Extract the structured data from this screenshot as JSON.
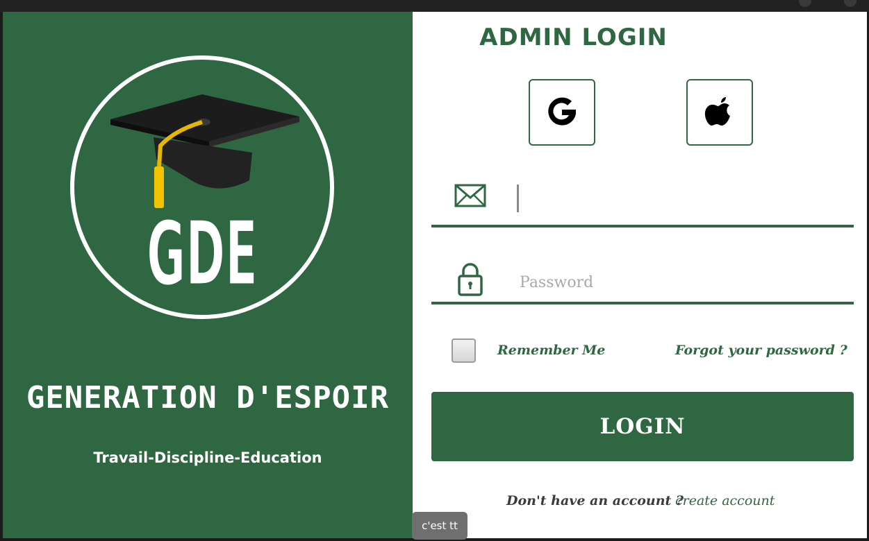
{
  "brand": {
    "logo_initials": "GDE",
    "name": "GENERATION D'ESPOIR",
    "motto": "Travail-Discipline-Education"
  },
  "login": {
    "title": "ADMIN LOGIN",
    "social": [
      {
        "icon": "google-icon"
      },
      {
        "icon": "apple-icon"
      }
    ],
    "email": {
      "value": "",
      "placeholder": "",
      "icon": "envelope-icon"
    },
    "password": {
      "value": "",
      "placeholder": "Password",
      "icon": "lock-icon"
    },
    "remember_me": {
      "label": "Remember Me",
      "checked": false
    },
    "forgot_label": "Forgot your password ?",
    "login_button": "LOGIN",
    "no_account_text": "Don't have an account ?",
    "create_account_label": "create account"
  },
  "tooltip": "c'est tt",
  "colors": {
    "primary_green": "#2f6742",
    "white": "#ffffff",
    "tooltip_bg": "#6f6f6f"
  }
}
